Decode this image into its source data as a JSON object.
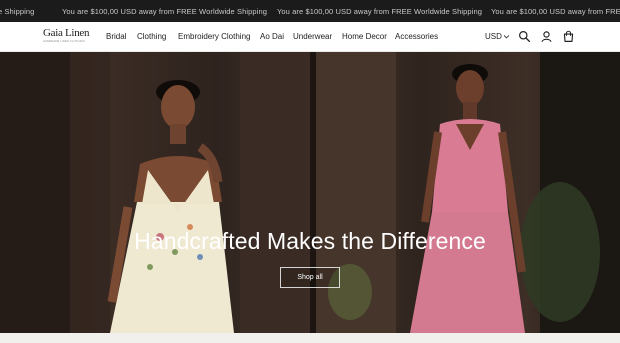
{
  "announcement": {
    "messages": [
      "e Shipping",
      "You are $100,00 USD away from FREE Worldwide Shipping",
      "You are $100,00 USD away from FREE Worldwide Shipping",
      "You are $100,00 USD away from FREE Worldwide Shipping"
    ]
  },
  "header": {
    "logo_name": "Gaia Linen",
    "logo_tagline": "HANDMADE LINEN CLOTHING",
    "nav": [
      "Bridal",
      "Clothing",
      "Embroidery Clothing",
      "Ao Dai",
      "Underwear",
      "Home Decor",
      "Accessories"
    ],
    "currency": "USD",
    "icons": [
      "search-icon",
      "account-icon",
      "cart-icon"
    ]
  },
  "hero": {
    "title": "Handcrafted Makes the Difference",
    "button_label": "Shop all"
  },
  "colors": {
    "announcement_bg": "#1b1b1b",
    "header_bg": "#ffffff",
    "hero_text": "#ffffff",
    "dress_left": "#efe9d2",
    "dress_right": "#d97c93"
  }
}
